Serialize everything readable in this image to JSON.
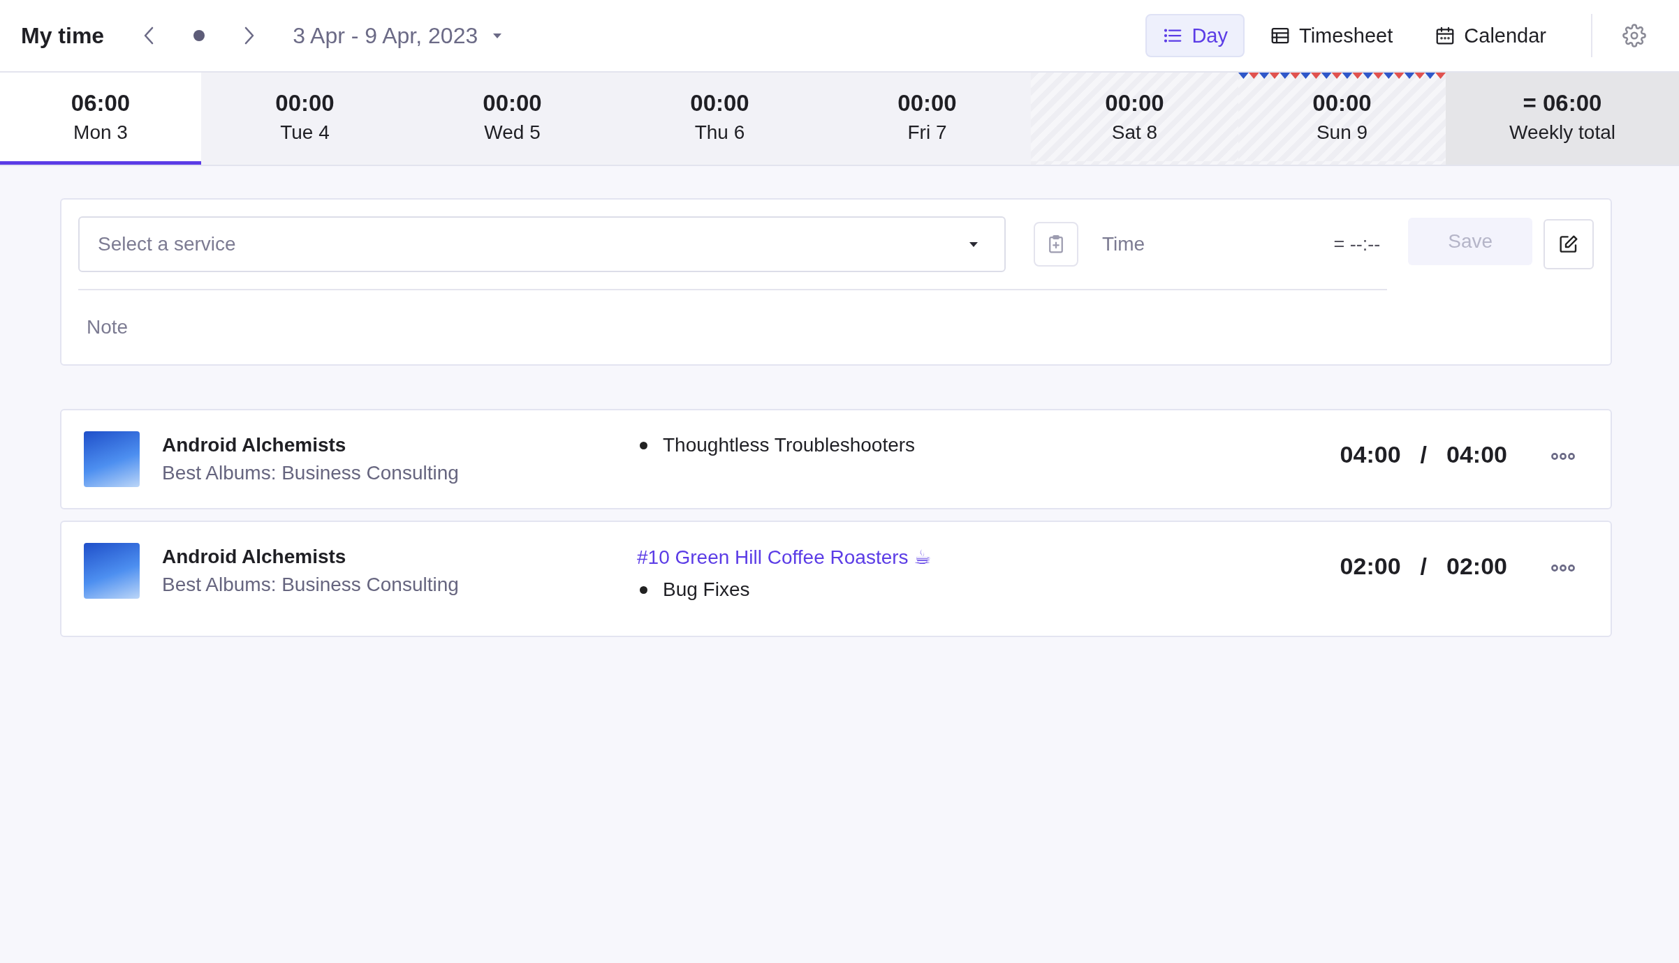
{
  "header": {
    "title": "My time",
    "date_range": "3 Apr - 9 Apr, 2023",
    "views": [
      {
        "label": "Day",
        "selected": true
      },
      {
        "label": "Timesheet",
        "selected": false
      },
      {
        "label": "Calendar",
        "selected": false
      }
    ]
  },
  "days": [
    {
      "time": "06:00",
      "label": "Mon 3",
      "kind": "weekday",
      "selected": true,
      "holiday": false
    },
    {
      "time": "00:00",
      "label": "Tue 4",
      "kind": "weekday",
      "selected": false,
      "holiday": false
    },
    {
      "time": "00:00",
      "label": "Wed 5",
      "kind": "weekday",
      "selected": false,
      "holiday": false
    },
    {
      "time": "00:00",
      "label": "Thu 6",
      "kind": "weekday",
      "selected": false,
      "holiday": false
    },
    {
      "time": "00:00",
      "label": "Fri 7",
      "kind": "weekday",
      "selected": false,
      "holiday": false
    },
    {
      "time": "00:00",
      "label": "Sat 8",
      "kind": "weekend",
      "selected": false,
      "holiday": false
    },
    {
      "time": "00:00",
      "label": "Sun 9",
      "kind": "weekend",
      "selected": false,
      "holiday": true
    }
  ],
  "weekly_total": {
    "time": "= 06:00",
    "label": "Weekly total"
  },
  "form": {
    "service": {
      "placeholder": "Select a service"
    },
    "time": {
      "placeholder": "Time"
    },
    "duration": "= --:--",
    "save": {
      "label": "Save",
      "disabled": true
    },
    "note": {
      "placeholder": "Note"
    }
  },
  "entries": [
    {
      "client": "Android Alchemists",
      "project": "Best Albums: Business Consulting",
      "task": "Thoughtless Troubleshooters",
      "tracked": "04:00",
      "separator": "/",
      "billable": "04:00"
    },
    {
      "client": "Android Alchemists",
      "project": "Best Albums: Business Consulting",
      "issue": "#10 Green Hill Coffee Roasters ☕",
      "task": "Bug Fixes",
      "tracked": "02:00",
      "separator": "/",
      "billable": "02:00"
    }
  ]
}
